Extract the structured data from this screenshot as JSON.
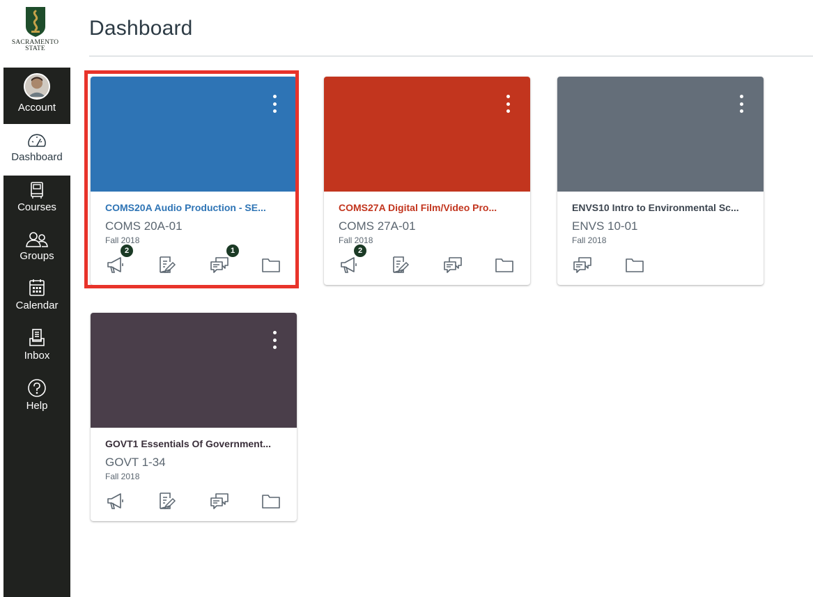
{
  "logo": {
    "line1": "SACRAMENTO",
    "line2": "STATE"
  },
  "nav": {
    "account": "Account",
    "dashboard": "Dashboard",
    "courses": "Courses",
    "groups": "Groups",
    "calendar": "Calendar",
    "inbox": "Inbox",
    "help": "Help",
    "active": "dashboard"
  },
  "header": {
    "title": "Dashboard"
  },
  "cards": [
    {
      "name": "COMS20A Audio Production - SE...",
      "code": "COMS 20A-01",
      "term": "Fall 2018",
      "hero_color": "#2e74b5",
      "name_color": "#2e74b5",
      "highlighted": true,
      "announcements_badge": "2",
      "discussions_badge": "1"
    },
    {
      "name": "COMS27A Digital Film/Video Pro...",
      "code": "COMS 27A-01",
      "term": "Fall 2018",
      "hero_color": "#c2351e",
      "name_color": "#c2351e",
      "highlighted": false,
      "announcements_badge": "2",
      "discussions_badge": ""
    },
    {
      "name": "ENVS10 Intro to Environmental Sc...",
      "code": "ENVS 10-01",
      "term": "Fall 2018",
      "hero_color": "#646e79",
      "name_color": "#3d4650",
      "highlighted": false,
      "announcements_badge": "",
      "discussions_badge": ""
    },
    {
      "name": "GOVT1 Essentials Of Government...",
      "code": "GOVT 1-34",
      "term": "Fall 2018",
      "hero_color": "#4a3e4a",
      "name_color": "#3a2f3a",
      "highlighted": false,
      "announcements_badge": "",
      "discussions_badge": ""
    }
  ],
  "colors": {
    "nav_bg": "#20221f",
    "highlight_border": "#e8332a",
    "badge_bg": "#1b3a25"
  }
}
